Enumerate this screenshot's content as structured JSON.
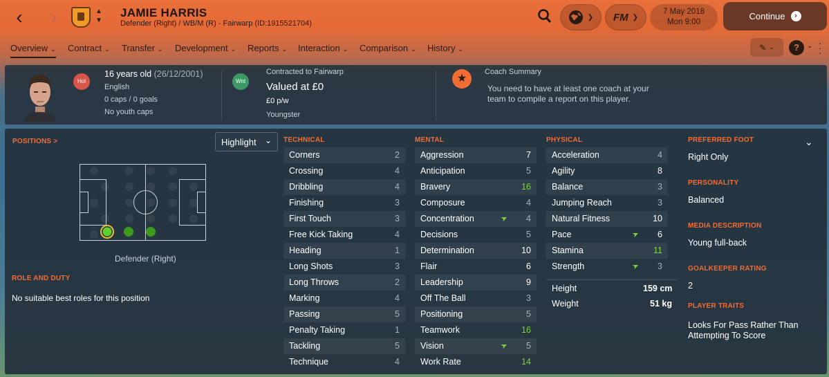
{
  "header": {
    "name": "JAMIE HARRIS",
    "subtitle": "Defender (Right) / WB/M (R) - Fairwarp (ID:1915521704)",
    "date": "7 May 2018",
    "time": "Mon 9:00",
    "fm_label": "FM",
    "continue_label": "Continue",
    "back_icon": "‹",
    "forward_icon": "›"
  },
  "tabs": [
    {
      "label": "Overview"
    },
    {
      "label": "Contract"
    },
    {
      "label": "Transfer"
    },
    {
      "label": "Development"
    },
    {
      "label": "Reports"
    },
    {
      "label": "Interaction"
    },
    {
      "label": "Comparison"
    },
    {
      "label": "History"
    }
  ],
  "info": {
    "age": "16 years old",
    "dob": "(26/12/2001)",
    "nationality": "English",
    "caps": "0 caps / 0 goals",
    "youth_caps": "No youth caps",
    "hol_badge": "Hol",
    "wnt_badge": "Wnt",
    "contract_label": "Contracted to Fairwarp",
    "value": "Valued at £0",
    "wage": "£0 p/w",
    "status": "Youngster",
    "coach_title": "Coach Summary",
    "coach_text": "You need to have at least one coach at your team to compile a report on this player."
  },
  "positions": {
    "title": "POSITIONS >",
    "highlight_label": "Highlight",
    "position_name": "Defender (Right)",
    "role_title": "ROLE AND DUTY",
    "role_text": "No suitable best roles for this position"
  },
  "attributes": {
    "technical_title": "TECHNICAL",
    "mental_title": "MENTAL",
    "physical_title": "PHYSICAL",
    "technical": [
      {
        "name": "Corners",
        "value": "2"
      },
      {
        "name": "Crossing",
        "value": "4"
      },
      {
        "name": "Dribbling",
        "value": "4"
      },
      {
        "name": "Finishing",
        "value": "3"
      },
      {
        "name": "First Touch",
        "value": "3"
      },
      {
        "name": "Free Kick Taking",
        "value": "4"
      },
      {
        "name": "Heading",
        "value": "1"
      },
      {
        "name": "Long Shots",
        "value": "3"
      },
      {
        "name": "Long Throws",
        "value": "2"
      },
      {
        "name": "Marking",
        "value": "4"
      },
      {
        "name": "Passing",
        "value": "5"
      },
      {
        "name": "Penalty Taking",
        "value": "1"
      },
      {
        "name": "Tackling",
        "value": "5"
      },
      {
        "name": "Technique",
        "value": "4"
      }
    ],
    "mental": [
      {
        "name": "Aggression",
        "value": "7"
      },
      {
        "name": "Anticipation",
        "value": "5"
      },
      {
        "name": "Bravery",
        "value": "16"
      },
      {
        "name": "Composure",
        "value": "4"
      },
      {
        "name": "Concentration",
        "value": "4",
        "arrow": true
      },
      {
        "name": "Decisions",
        "value": "5"
      },
      {
        "name": "Determination",
        "value": "10"
      },
      {
        "name": "Flair",
        "value": "6"
      },
      {
        "name": "Leadership",
        "value": "9"
      },
      {
        "name": "Off The Ball",
        "value": "3"
      },
      {
        "name": "Positioning",
        "value": "5"
      },
      {
        "name": "Teamwork",
        "value": "16"
      },
      {
        "name": "Vision",
        "value": "5",
        "arrow": true
      },
      {
        "name": "Work Rate",
        "value": "14"
      }
    ],
    "physical": [
      {
        "name": "Acceleration",
        "value": "4"
      },
      {
        "name": "Agility",
        "value": "8"
      },
      {
        "name": "Balance",
        "value": "3"
      },
      {
        "name": "Jumping Reach",
        "value": "3"
      },
      {
        "name": "Natural Fitness",
        "value": "10"
      },
      {
        "name": "Pace",
        "value": "6",
        "arrow": true
      },
      {
        "name": "Stamina",
        "value": "11"
      },
      {
        "name": "Strength",
        "value": "3",
        "arrow": true
      }
    ],
    "height_label": "Height",
    "height": "159 cm",
    "weight_label": "Weight",
    "weight": "51 kg"
  },
  "side": {
    "foot_title": "PREFERRED FOOT",
    "foot": "Right Only",
    "personality_title": "PERSONALITY",
    "personality": "Balanced",
    "media_title": "MEDIA DESCRIPTION",
    "media": "Young full-back",
    "gk_title": "GOALKEEPER RATING",
    "gk": "2",
    "traits_title": "PLAYER TRAITS",
    "traits": "Looks For Pass Rather Than Attempting To Score"
  },
  "colors": {
    "accent": "#f26d33",
    "green": "#7fd33f",
    "panel": "#24303c",
    "header": "#e8703a"
  }
}
